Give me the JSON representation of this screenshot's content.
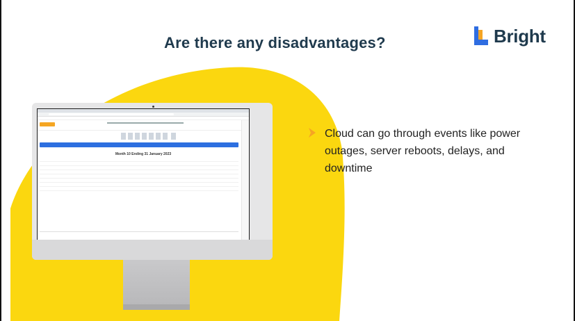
{
  "slide": {
    "title": "Are there any disadvantages?",
    "logo_text": "Bright",
    "bullets": [
      "Cloud can go through events like power outages, server reboots, delays, and downtime"
    ]
  },
  "monitor_screen": {
    "heading": "Month 10 Ending 31 January 2023"
  },
  "colors": {
    "accent_yellow": "#fbd70f",
    "logo_blue": "#2f6de1",
    "logo_orange": "#f5a524",
    "title": "#1f3a4d",
    "bullet_arrow": "#f5a524",
    "timeline_blue": "#2d6fe0"
  },
  "icons": {
    "logo": "bright-logo-icon",
    "bullet": "chevron-right-icon"
  }
}
